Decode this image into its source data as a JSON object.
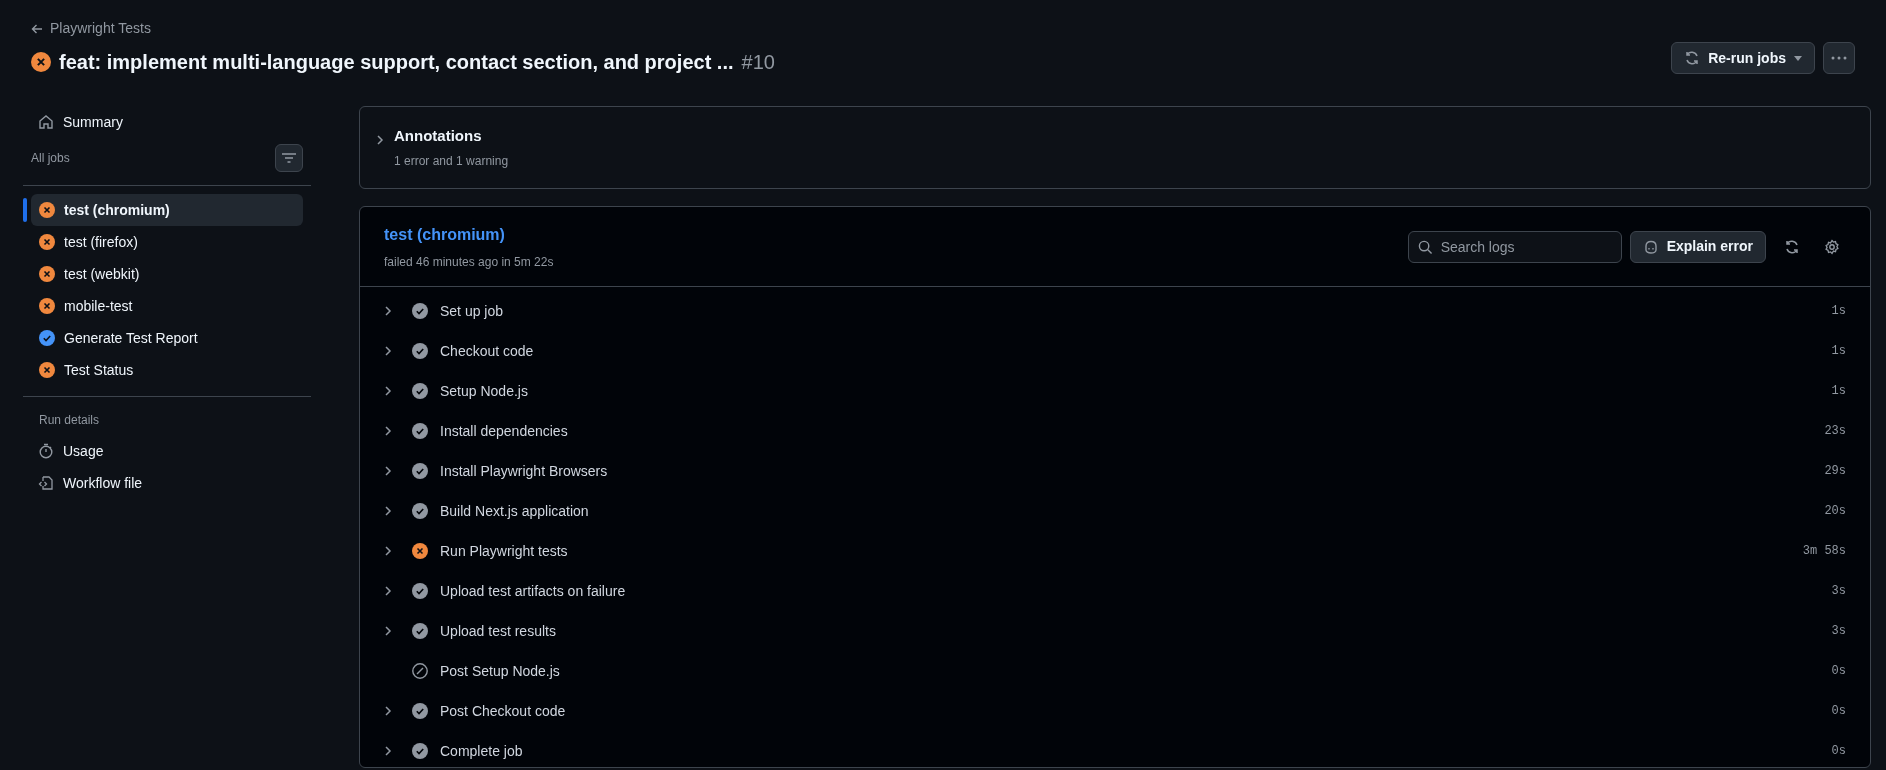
{
  "header": {
    "back_link": "Playwright Tests",
    "kind": "failure",
    "title": "feat: implement multi-language support, contact section, and project ...",
    "run_number": "#10",
    "rerun_button": "Re-run jobs"
  },
  "sidebar": {
    "summary": "Summary",
    "jobs_heading": "All jobs",
    "jobs": [
      {
        "label": "test (chromium)",
        "kind": "failure",
        "selected": true
      },
      {
        "label": "test (firefox)",
        "kind": "failure",
        "selected": false
      },
      {
        "label": "test (webkit)",
        "kind": "failure",
        "selected": false
      },
      {
        "label": "mobile-test",
        "kind": "failure",
        "selected": false
      },
      {
        "label": "Generate Test Report",
        "kind": "success",
        "selected": false
      },
      {
        "label": "Test Status",
        "kind": "failure",
        "selected": false
      }
    ],
    "run_details_heading": "Run details",
    "run_details": [
      {
        "label": "Usage",
        "kind": "usage"
      },
      {
        "label": "Workflow file",
        "kind": "workflow"
      }
    ]
  },
  "annotations": {
    "title": "Annotations",
    "summary": "1 error and 1 warning"
  },
  "job": {
    "title": "test (chromium)",
    "subtitle": "failed 46 minutes ago in 5m 22s",
    "search": {
      "placeholder": "Search logs"
    },
    "explain_button": "Explain error",
    "steps": [
      {
        "label": "Set up job",
        "kind": "success",
        "duration": "1s"
      },
      {
        "label": "Checkout code",
        "kind": "success",
        "duration": "1s"
      },
      {
        "label": "Setup Node.js",
        "kind": "success",
        "duration": "1s"
      },
      {
        "label": "Install dependencies",
        "kind": "success",
        "duration": "23s"
      },
      {
        "label": "Install Playwright Browsers",
        "kind": "success",
        "duration": "29s"
      },
      {
        "label": "Build Next.js application",
        "kind": "success",
        "duration": "20s"
      },
      {
        "label": "Run Playwright tests",
        "kind": "failure",
        "duration": "3m 58s"
      },
      {
        "label": "Upload test artifacts on failure",
        "kind": "success",
        "duration": "3s"
      },
      {
        "label": "Upload test results",
        "kind": "success",
        "duration": "3s"
      },
      {
        "label": "Post Setup Node.js",
        "kind": "skipped",
        "duration": "0s"
      },
      {
        "label": "Post Checkout code",
        "kind": "success",
        "duration": "0s"
      },
      {
        "label": "Complete job",
        "kind": "success",
        "duration": "0s"
      }
    ]
  }
}
